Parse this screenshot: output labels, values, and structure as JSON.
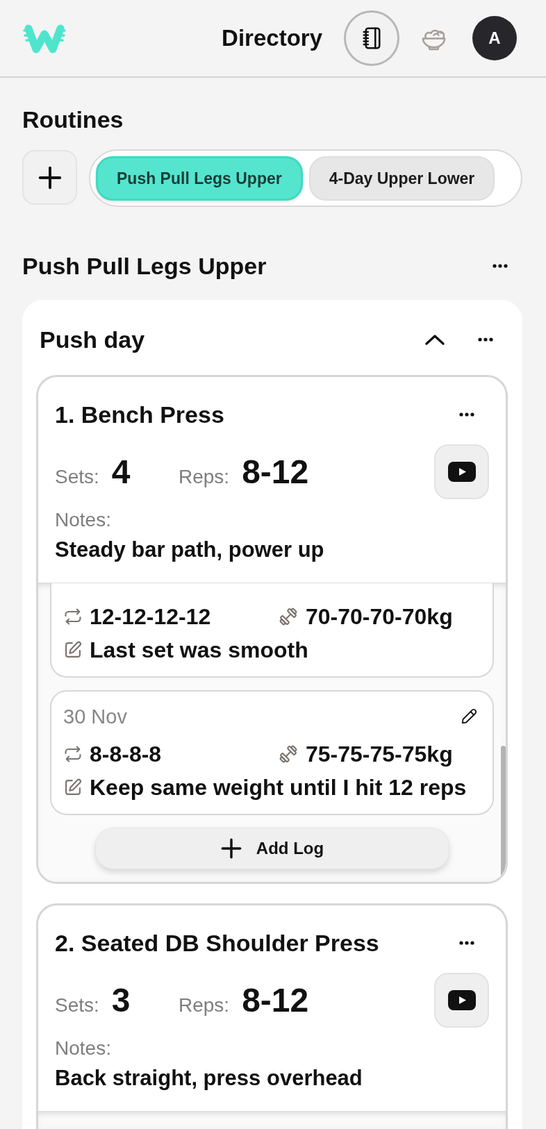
{
  "header": {
    "title": "Directory",
    "nav": [
      {
        "kind": "notebook",
        "selected": true
      },
      {
        "kind": "bowl",
        "selected": false
      }
    ],
    "avatar": "A"
  },
  "routines": {
    "title": "Routines",
    "tabs": [
      {
        "label": "Push Pull Legs Upper",
        "selected": true
      },
      {
        "label": "4-Day Upper Lower",
        "selected": false
      }
    ]
  },
  "routine": {
    "title": "Push Pull Legs Upper",
    "days": [
      {
        "title": "Push day",
        "expanded": true,
        "exercises": [
          {
            "title": "1. Bench Press",
            "sets_label": "Sets:",
            "sets": "4",
            "reps_label": "Reps:",
            "reps": "8-12",
            "notes_label": "Notes:",
            "notes": "Steady bar path, power up",
            "logs": [
              {
                "cut_off": true,
                "reps": "12-12-12-12",
                "weights": "70-70-70-70kg",
                "note": "Last set was smooth"
              },
              {
                "cut_off": false,
                "date": "30 Nov",
                "reps": "8-8-8-8",
                "weights": "75-75-75-75kg",
                "note": "Keep same weight until I hit 12 reps"
              }
            ],
            "add_log": "Add Log"
          },
          {
            "title": "2. Seated DB Shoulder Press",
            "sets_label": "Sets:",
            "sets": "3",
            "reps_label": "Reps:",
            "reps": "8-12",
            "notes_label": "Notes:",
            "notes": "Back straight, press overhead"
          }
        ]
      }
    ]
  }
}
